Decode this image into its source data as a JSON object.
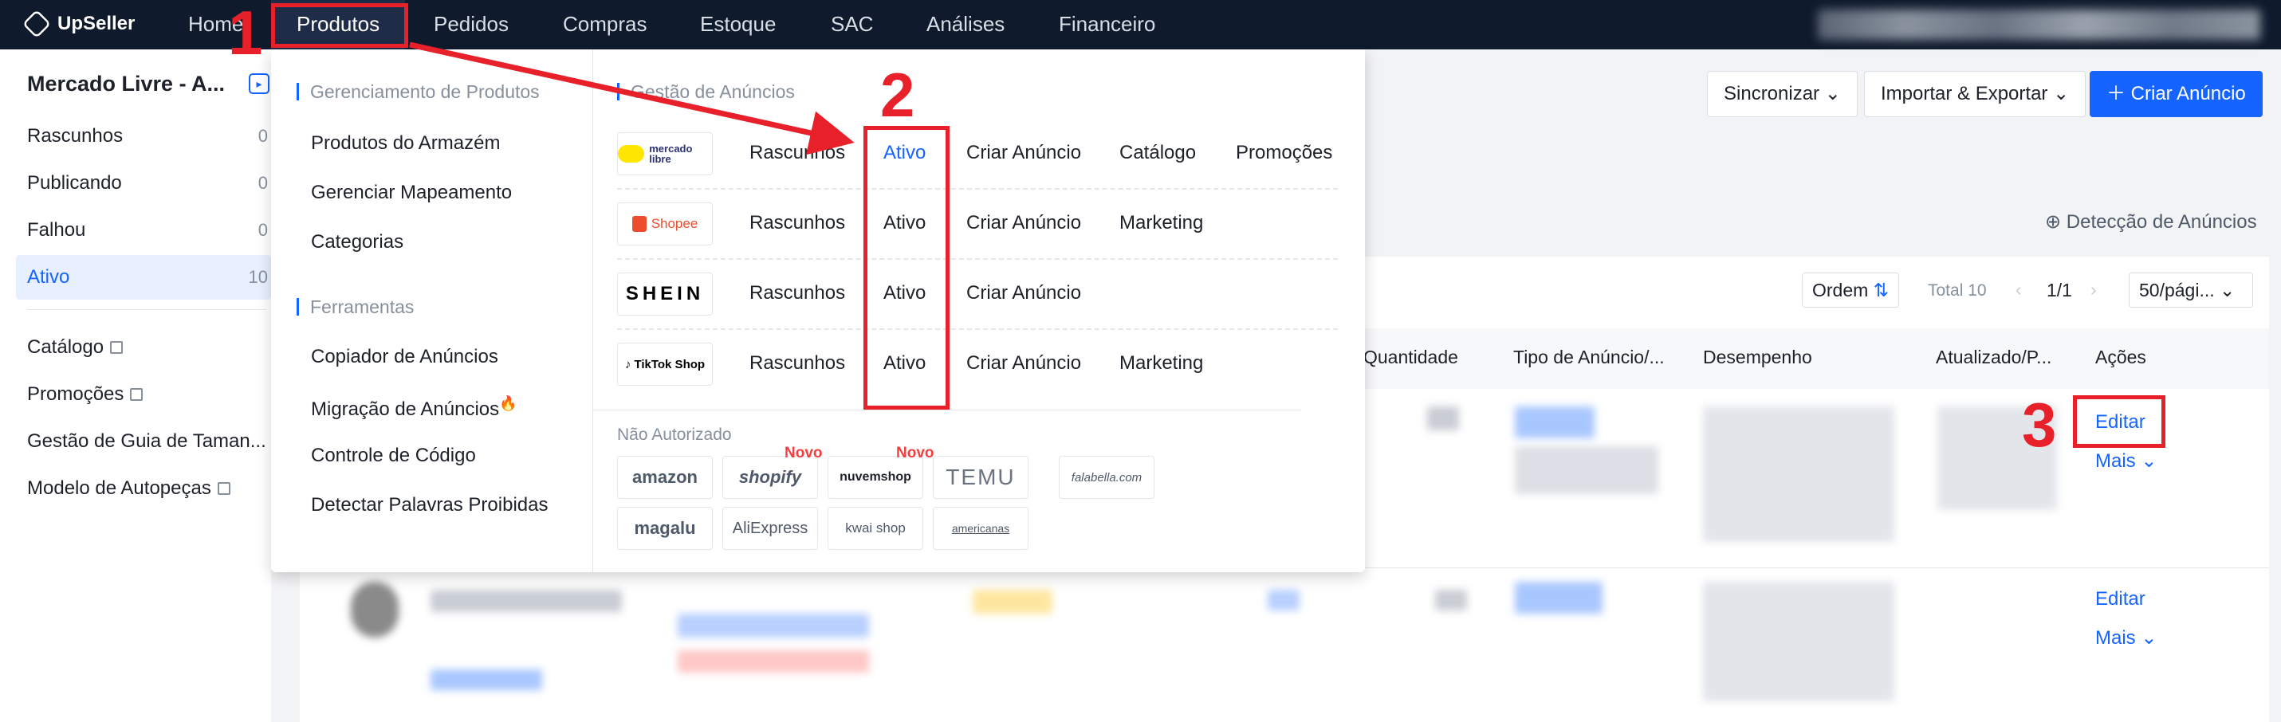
{
  "topbar": {
    "logo": "UpSeller",
    "nav": [
      "Home",
      "Produtos",
      "Pedidos",
      "Compras",
      "Estoque",
      "SAC",
      "Análises",
      "Financeiro"
    ]
  },
  "sidebar": {
    "store_title": "Mercado Livre - A...",
    "items": [
      {
        "label": "Rascunhos",
        "count": "0"
      },
      {
        "label": "Publicando",
        "count": "0"
      },
      {
        "label": "Falhou",
        "count": "0"
      },
      {
        "label": "Ativo",
        "count": "10"
      }
    ],
    "links": [
      "Catálogo",
      "Promoções",
      "Gestão de Guia de Taman...",
      "Modelo de Autopeças"
    ]
  },
  "toolbar": {
    "sync": "Sincronizar",
    "import_export": "Importar & Exportar",
    "create": "Criar Anúncio",
    "detect": "Detecção de Anúncios"
  },
  "pager": {
    "order": "Ordem",
    "total": "Total 10",
    "page": "1/1",
    "per_page": "50/pági..."
  },
  "table": {
    "headers": [
      "Quantidade",
      "Tipo de Anúncio/...",
      "Desempenho",
      "Atualizado/P...",
      "Ações"
    ],
    "rows": [
      {
        "edit": "Editar",
        "more": "Mais"
      },
      {
        "edit": "Editar",
        "more": "Mais"
      }
    ]
  },
  "dropdown": {
    "group1_title": "Gerenciamento de Produtos",
    "group1_links": [
      "Produtos do Armazém",
      "Gerenciar Mapeamento",
      "Categorias"
    ],
    "group2_title": "Ferramentas",
    "group2_links": [
      "Copiador de Anúncios",
      "Migração de Anúncios",
      "Controle de Código",
      "Detectar Palavras Proibidas"
    ],
    "right_title": "Gestão de Anúncios",
    "markets": [
      {
        "logo": "mercado libre",
        "links": [
          "Rascunhos",
          "Ativo",
          "Criar Anúncio",
          "Catálogo",
          "Promoções"
        ]
      },
      {
        "logo": "Shopee",
        "links": [
          "Rascunhos",
          "Ativo",
          "Criar Anúncio",
          "Marketing"
        ]
      },
      {
        "logo": "SHEIN",
        "links": [
          "Rascunhos",
          "Ativo",
          "Criar Anúncio"
        ]
      },
      {
        "logo": "TikTok Shop",
        "links": [
          "Rascunhos",
          "Ativo",
          "Criar Anúncio",
          "Marketing"
        ]
      }
    ],
    "unauthorized_label": "Não Autorizado",
    "unauthorized": [
      "amazon",
      "shopify",
      "nuvemshop",
      "TEMU",
      "falabella.com",
      "magalu",
      "AliExpress",
      "kwai shop",
      "americanas"
    ],
    "new_badge": "Novo"
  },
  "annotations": [
    "1",
    "2",
    "3"
  ],
  "colors": {
    "accent": "#1664ff",
    "annotation": "#e8202a",
    "topbar": "#0f1b2d"
  }
}
